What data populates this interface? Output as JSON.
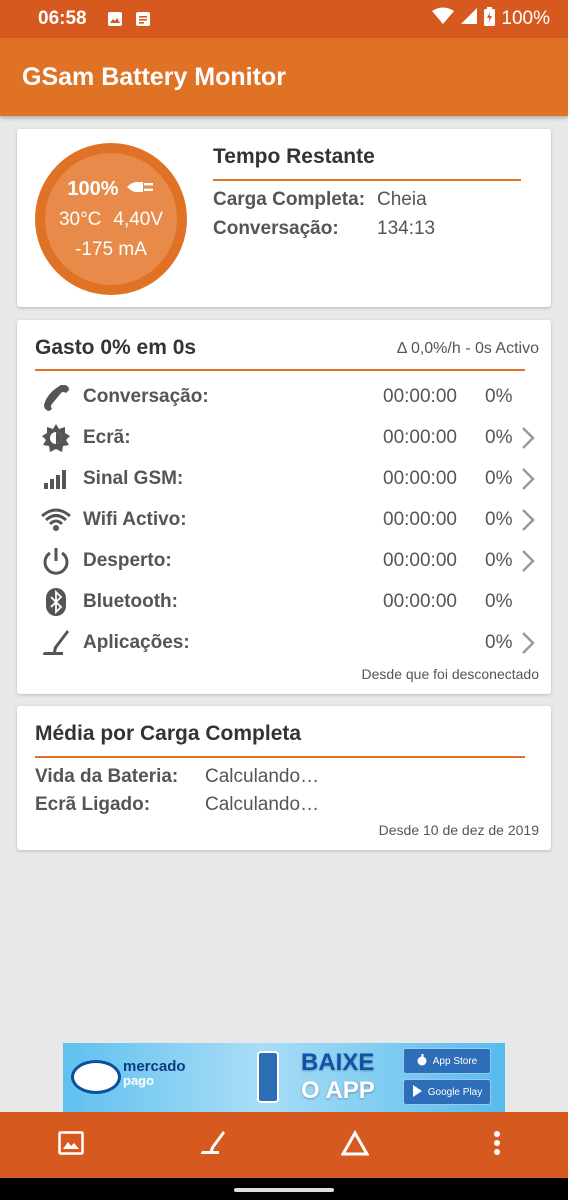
{
  "status_bar": {
    "time": "06:58",
    "battery": "100%"
  },
  "app": {
    "title": "GSam Battery Monitor"
  },
  "gauge": {
    "percent": "100%",
    "temperature": "30°C",
    "voltage": "4,40V",
    "current": "-175 mA"
  },
  "time_remaining": {
    "title": "Tempo Restante",
    "rows": [
      {
        "label": "Carga Completa:",
        "value": "Cheia"
      },
      {
        "label": "Conversação:",
        "value": "134:13"
      }
    ]
  },
  "usage": {
    "title": "Gasto 0% em 0s",
    "delta": "Δ 0,0%/h - 0s Activo",
    "rows": [
      {
        "icon": "phone-icon",
        "name": "Conversação:",
        "time": "00:00:00",
        "percent": "0%",
        "has_arrow": false
      },
      {
        "icon": "brightness-icon",
        "name": "Ecrã:",
        "time": "00:00:00",
        "percent": "0%",
        "has_arrow": true
      },
      {
        "icon": "signal-icon",
        "name": "Sinal GSM:",
        "time": "00:00:00",
        "percent": "0%",
        "has_arrow": true
      },
      {
        "icon": "wifi-icon",
        "name": "Wifi Activo:",
        "time": "00:00:00",
        "percent": "0%",
        "has_arrow": true
      },
      {
        "icon": "power-icon",
        "name": "Desperto:",
        "time": "00:00:00",
        "percent": "0%",
        "has_arrow": true
      },
      {
        "icon": "bluetooth-icon",
        "name": "Bluetooth:",
        "time": "00:00:00",
        "percent": "0%",
        "has_arrow": false
      },
      {
        "icon": "apps-icon",
        "name": "Aplicações:",
        "time": "",
        "percent": "0%",
        "has_arrow": true
      }
    ],
    "footer": "Desde que foi desconectado"
  },
  "average": {
    "title": "Média por Carga Completa",
    "rows": [
      {
        "label": "Vida da Bateria:",
        "value": "Calculando…"
      },
      {
        "label": "Ecrã Ligado:",
        "value": "Calculando…"
      }
    ],
    "footer": "Desde 10 de dez de 2019"
  },
  "ad": {
    "brand_line1": "mercado",
    "brand_line2": "pago",
    "cta_line1": "BAIXE",
    "cta_line2": "O APP",
    "store1": "App Store",
    "store2": "Google Play"
  },
  "colors": {
    "primary_dark": "#d65a1f",
    "primary": "#e07226",
    "gauge_inner": "#e88b4a"
  }
}
